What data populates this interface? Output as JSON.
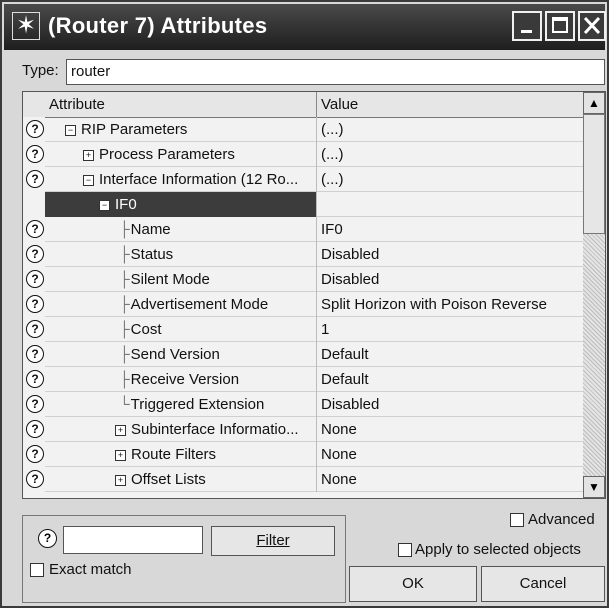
{
  "window": {
    "title": "(Router 7) Attributes"
  },
  "type": {
    "label": "Type:",
    "value": "router"
  },
  "grid": {
    "header": {
      "attribute": "Attribute",
      "value": "Value"
    },
    "rows": [
      {
        "attr": "RIP Parameters",
        "value": "(...)",
        "help": true,
        "exp": "minus",
        "indent": 42,
        "tree": "",
        "selected": false
      },
      {
        "attr": "Process Parameters",
        "value": "(...)",
        "help": true,
        "exp": "plus",
        "indent": 60,
        "tree": "",
        "selected": false
      },
      {
        "attr": "Interface Information (12 Ro...",
        "value": "(...)",
        "help": true,
        "exp": "minus",
        "indent": 60,
        "tree": "",
        "selected": false
      },
      {
        "attr": "IF0",
        "value": "",
        "help": false,
        "exp": "minus",
        "indent": 76,
        "tree": "",
        "selected": true
      },
      {
        "attr": "Name",
        "value": "IF0",
        "help": true,
        "exp": "",
        "indent": 96,
        "tree": "├",
        "selected": false
      },
      {
        "attr": "Status",
        "value": "Disabled",
        "help": true,
        "exp": "",
        "indent": 96,
        "tree": "├",
        "selected": false
      },
      {
        "attr": "Silent Mode",
        "value": "Disabled",
        "help": true,
        "exp": "",
        "indent": 96,
        "tree": "├",
        "selected": false
      },
      {
        "attr": "Advertisement Mode",
        "value": "Split Horizon with Poison Reverse",
        "help": true,
        "exp": "",
        "indent": 96,
        "tree": "├",
        "selected": false
      },
      {
        "attr": "Cost",
        "value": "1",
        "help": true,
        "exp": "",
        "indent": 96,
        "tree": "├",
        "selected": false
      },
      {
        "attr": "Send Version",
        "value": "Default",
        "help": true,
        "exp": "",
        "indent": 96,
        "tree": "├",
        "selected": false
      },
      {
        "attr": "Receive Version",
        "value": "Default",
        "help": true,
        "exp": "",
        "indent": 96,
        "tree": "├",
        "selected": false
      },
      {
        "attr": "Triggered Extension",
        "value": "Disabled",
        "help": true,
        "exp": "",
        "indent": 96,
        "tree": "└",
        "selected": false
      },
      {
        "attr": "Subinterface Informatio...",
        "value": "None",
        "help": true,
        "exp": "plus",
        "indent": 92,
        "tree": "",
        "selected": false
      },
      {
        "attr": "Route Filters",
        "value": "None",
        "help": true,
        "exp": "plus",
        "indent": 92,
        "tree": "",
        "selected": false
      },
      {
        "attr": "Offset Lists",
        "value": "None",
        "help": true,
        "exp": "plus",
        "indent": 92,
        "tree": "",
        "selected": false
      }
    ]
  },
  "filter": {
    "button": "Filter",
    "exact_match": "Exact match",
    "exact_checked": false
  },
  "options": {
    "advanced": "Advanced",
    "advanced_checked": false,
    "apply_selected": "Apply to selected objects",
    "apply_checked": false
  },
  "buttons": {
    "ok": "OK",
    "cancel": "Cancel"
  },
  "colors": {
    "titlebar": "#2a2a2a",
    "selection": "#3c3c3c"
  }
}
